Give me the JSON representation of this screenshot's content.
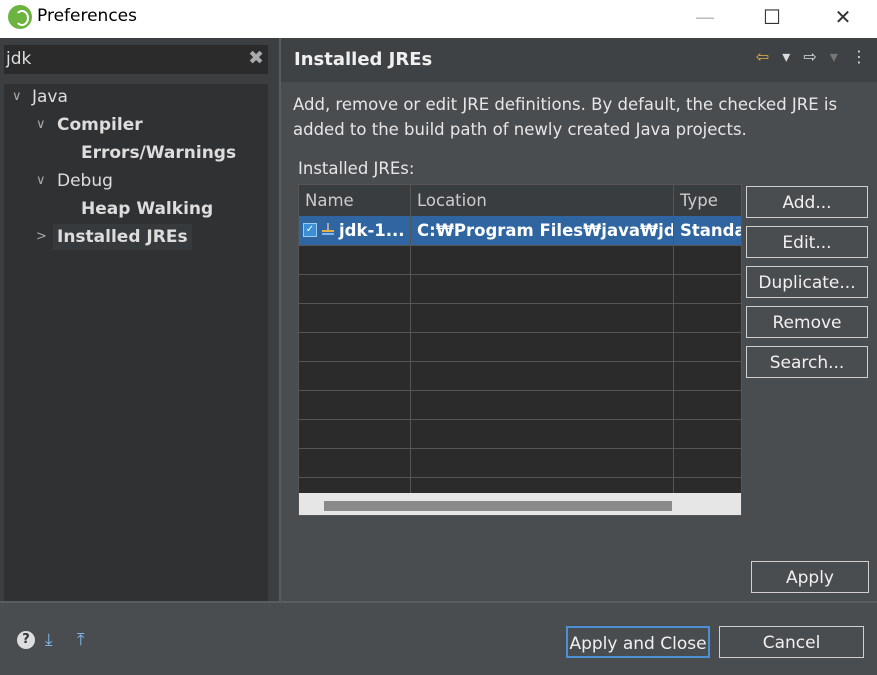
{
  "window": {
    "title": "Preferences"
  },
  "filter": {
    "value": "jdk"
  },
  "tree": {
    "java": "Java",
    "compiler": "Compiler",
    "errors_warnings": "Errors/Warnings",
    "debug": "Debug",
    "heap_walking": "Heap Walking",
    "installed_jres": "Installed JREs"
  },
  "page": {
    "title": "Installed JREs",
    "description_line1": "Add, remove or edit JRE definitions. By default, the checked JRE is",
    "description_line2": "added to the build path of newly created Java projects.",
    "table_label": "Installed JREs:"
  },
  "table": {
    "headers": {
      "name": "Name",
      "location": "Location",
      "type": "Type"
    },
    "rows": [
      {
        "name": "jdk-1...",
        "location": "C:₩Program Files₩java₩jd...",
        "type": "Standa",
        "checked": true
      }
    ]
  },
  "buttons": {
    "add": "Add...",
    "edit": "Edit...",
    "duplicate": "Duplicate...",
    "remove": "Remove",
    "search": "Search...",
    "apply": "Apply",
    "apply_close": "Apply and Close",
    "cancel": "Cancel"
  },
  "colors": {
    "selection": "#2f65a0",
    "spring_green": "#6db33f",
    "nav_back": "#e8b04a"
  }
}
